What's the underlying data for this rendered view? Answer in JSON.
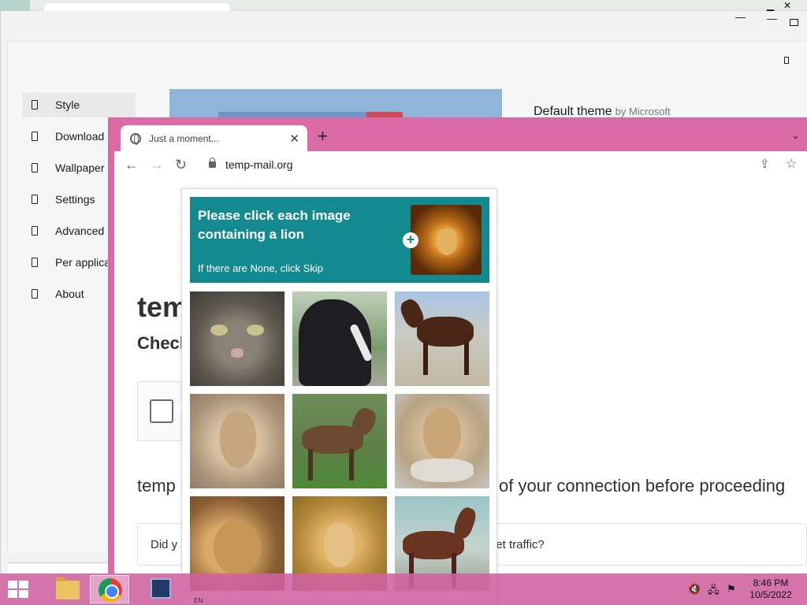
{
  "settings": {
    "sidebar": [
      {
        "label": "Style"
      },
      {
        "label": "Download"
      },
      {
        "label": "Wallpaper"
      },
      {
        "label": "Settings"
      },
      {
        "label": "Advanced"
      },
      {
        "label": "Per applica"
      },
      {
        "label": "About"
      }
    ],
    "theme_name": "Default theme",
    "theme_author": "by Microsoft"
  },
  "browser": {
    "tab_title": "Just a moment...",
    "url": "temp-mail.org",
    "page": {
      "heading": "tem",
      "subheading": "Check",
      "text_left": "temp",
      "text_right": "of your connection before proceeding",
      "info_left": "Did y",
      "info_right": "net traffic?"
    }
  },
  "captcha": {
    "prompt": "Please click each image containing a lion",
    "subtext": "If there are None, click Skip",
    "plus": "+",
    "tiles": [
      "cat",
      "black horse",
      "brown horse",
      "lioness",
      "horse",
      "lioness",
      "lion",
      "lion",
      "horse"
    ]
  },
  "taskbar": {
    "time": "8:46 PM",
    "date": "10/5/2022",
    "lang": "EN"
  }
}
